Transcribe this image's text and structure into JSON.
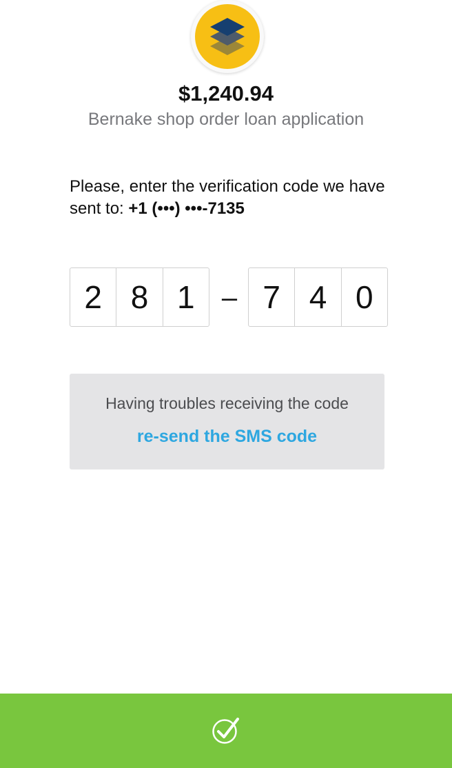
{
  "header": {
    "amount": "$1,240.94",
    "subtitle": "Bernake shop order loan application",
    "logo_icon": "layers-icon",
    "logo_color": "#f7bf14"
  },
  "verification": {
    "prompt": "Please, enter the verification code we have sent to:",
    "phone": "+1 (•••) •••-7135",
    "code_first": [
      "2",
      "8",
      "1"
    ],
    "separator": "–",
    "code_second": [
      "7",
      "4",
      "0"
    ]
  },
  "help": {
    "text": "Having troubles receiving the code",
    "resend_label": "re-send the SMS code",
    "link_color": "#2ea7e0"
  },
  "footer": {
    "confirm_icon": "check-circle-icon",
    "bar_color": "#79c63e"
  }
}
